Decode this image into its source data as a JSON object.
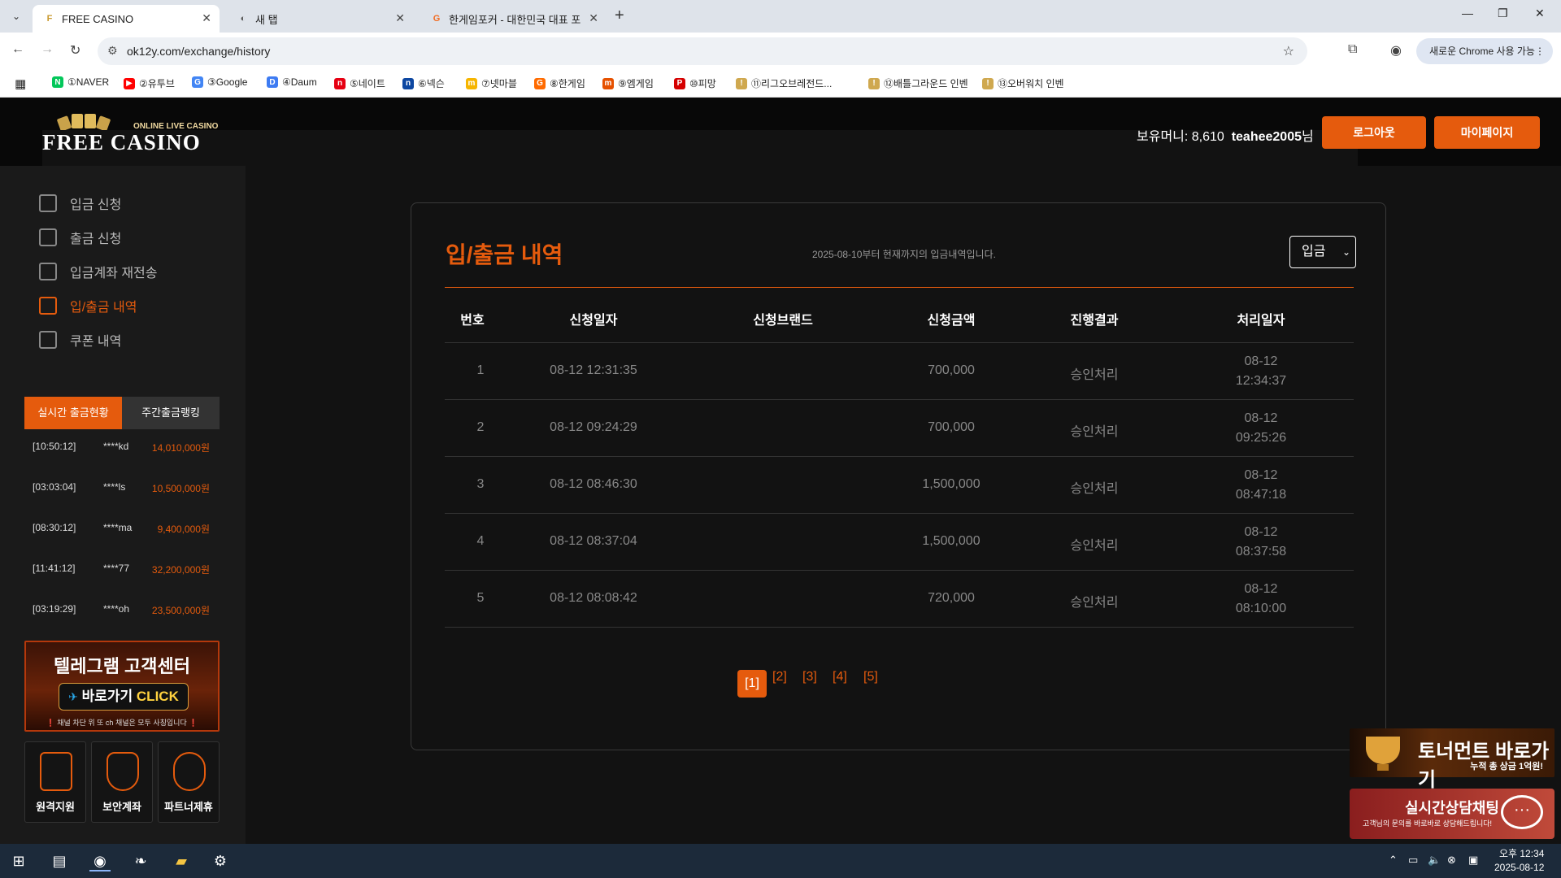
{
  "browser": {
    "tabs": [
      {
        "label": "FREE CASINO",
        "fav": "F"
      },
      {
        "label": "새 탭",
        "fav": "◐"
      },
      {
        "label": "한게임포커 - 대한민국 대표 포",
        "fav": "G"
      }
    ],
    "url": "ok12y.com/exchange/history",
    "update_label": "새로운 Chrome 사용 가능",
    "bookmarks": [
      {
        "label": "①NAVER",
        "icon": "N",
        "color": "#03c75a"
      },
      {
        "label": "②유투브",
        "icon": "▶",
        "color": "#ff0000"
      },
      {
        "label": "③Google",
        "icon": "G",
        "color": "#4285f4"
      },
      {
        "label": "④Daum",
        "icon": "D",
        "color": "#3d7bf2"
      },
      {
        "label": "⑤네이트",
        "icon": "n",
        "color": "#e60012"
      },
      {
        "label": "⑥넥슨",
        "icon": "n",
        "color": "#0d47a1"
      },
      {
        "label": "⑦넷마블",
        "icon": "m",
        "color": "#f6b500"
      },
      {
        "label": "⑧한게임",
        "icon": "G",
        "color": "#ff6b00"
      },
      {
        "label": "⑨엠게임",
        "icon": "m",
        "color": "#e65100"
      },
      {
        "label": "⑩피망",
        "icon": "P",
        "color": "#d50000"
      },
      {
        "label": "⑪리그오브레전드...",
        "icon": "!",
        "color": "#cfa84f"
      },
      {
        "label": "⑫배틀그라운드 인벤",
        "icon": "!",
        "color": "#cfa84f"
      },
      {
        "label": "⑬오버워치 인벤",
        "icon": "!",
        "color": "#cfa84f"
      }
    ]
  },
  "header": {
    "logo_sub": "ONLINE LIVE CASINO",
    "logo_main": "FREE CASINO",
    "money_label": "보유머니: 8,610",
    "username": "teahee2005",
    "suffix": "님",
    "logout": "로그아웃",
    "mypage": "마이페이지"
  },
  "sidebar": {
    "menu": [
      {
        "label": "입금 신청",
        "active": false
      },
      {
        "label": "출금 신청",
        "active": false
      },
      {
        "label": "입금계좌 재전송",
        "active": false
      },
      {
        "label": "입/출금 내역",
        "active": true
      },
      {
        "label": "쿠폰 내역",
        "active": false
      }
    ],
    "rank_tabs": [
      "실시간 출금현황",
      "주간출금랭킹"
    ],
    "rank_rows": [
      {
        "time": "[10:50:12]",
        "user": "****kd",
        "amount": "14,010,000원"
      },
      {
        "time": "[03:03:04]",
        "user": "****ls",
        "amount": "10,500,000원"
      },
      {
        "time": "[08:30:12]",
        "user": "****ma",
        "amount": "9,400,000원"
      },
      {
        "time": "[11:41:12]",
        "user": "****77",
        "amount": "32,200,000원"
      },
      {
        "time": "[03:19:29]",
        "user": "****oh",
        "amount": "23,500,000원"
      }
    ],
    "telegram": {
      "title": "텔레그램 고객센터",
      "btn_a": "바로가기 ",
      "btn_b": "CLICK",
      "note": "❗ 채널 차단 위 또 ch 채널은 모두 사칭입니다 ❗"
    },
    "quick": [
      "원격지원",
      "보안계좌",
      "파트너제휴"
    ]
  },
  "panel": {
    "title": "입/출금 내역",
    "note": "2025-08-10부터 현재까지의 입금내역입니다.",
    "select": "입금",
    "headers": [
      "번호",
      "신청일자",
      "신청브랜드",
      "신청금액",
      "진행결과",
      "처리일자"
    ],
    "rows": [
      {
        "no": "1",
        "date": "08-12 12:31:35",
        "brand": "",
        "amount": "700,000",
        "result": "승인처리",
        "proc_date": "08-12",
        "proc_time": "12:34:37"
      },
      {
        "no": "2",
        "date": "08-12 09:24:29",
        "brand": "",
        "amount": "700,000",
        "result": "승인처리",
        "proc_date": "08-12",
        "proc_time": "09:25:26"
      },
      {
        "no": "3",
        "date": "08-12 08:46:30",
        "brand": "",
        "amount": "1,500,000",
        "result": "승인처리",
        "proc_date": "08-12",
        "proc_time": "08:47:18"
      },
      {
        "no": "4",
        "date": "08-12 08:37:04",
        "brand": "",
        "amount": "1,500,000",
        "result": "승인처리",
        "proc_date": "08-12",
        "proc_time": "08:37:58"
      },
      {
        "no": "5",
        "date": "08-12 08:08:42",
        "brand": "",
        "amount": "720,000",
        "result": "승인처리",
        "proc_date": "08-12",
        "proc_time": "08:10:00"
      }
    ],
    "pages": [
      "[1]",
      "[2]",
      "[3]",
      "[4]",
      "[5]"
    ]
  },
  "float": {
    "tourney_title": "토너먼트 바로가기",
    "tourney_sub": "누적 총 상금 1억원!",
    "chat_title": "실시간상담채팅",
    "chat_sub": "고객님의 문의를 바로바로 상담해드립니다!"
  },
  "taskbar": {
    "ampm": "오후 12:34",
    "date": "2025-08-12"
  },
  "colors": {
    "accent": "#e55b0d",
    "bg": "#121212"
  }
}
